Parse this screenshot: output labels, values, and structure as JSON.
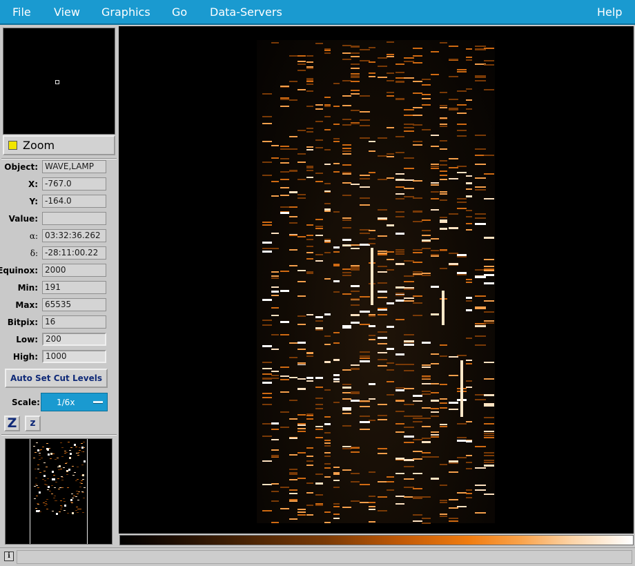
{
  "menu": {
    "file": "File",
    "view": "View",
    "graphics": "Graphics",
    "go": "Go",
    "data_servers": "Data-Servers",
    "help": "Help"
  },
  "zoom": {
    "label": "Zoom",
    "indicator_color": "#f2e600"
  },
  "info": {
    "object": {
      "label": "Object:",
      "value": "WAVE,LAMP"
    },
    "x": {
      "label": "X:",
      "value": "-767.0"
    },
    "y": {
      "label": "Y:",
      "value": "-164.0"
    },
    "value": {
      "label": "Value:",
      "value": ""
    },
    "alpha": {
      "label": "α:",
      "value": "03:32:36.262"
    },
    "delta": {
      "label": "δ:",
      "value": "-28:11:00.22"
    },
    "equinox": {
      "label": "Equinox:",
      "value": "2000"
    },
    "min": {
      "label": "Min:",
      "value": "191"
    },
    "max": {
      "label": "Max:",
      "value": "65535"
    },
    "bitpix": {
      "label": "Bitpix:",
      "value": "16"
    },
    "low": {
      "label": "Low:",
      "value": "200"
    },
    "high": {
      "label": "High:",
      "value": "1000"
    }
  },
  "controls": {
    "auto_cut": "Auto Set Cut Levels",
    "scale_label": "Scale:",
    "scale_value": "1/6x",
    "zoom_in": "Z",
    "zoom_out": "z"
  },
  "status": {
    "icon": "i",
    "text": ""
  },
  "colors": {
    "menubar": "#1a9ad0",
    "panel": "#c9c9c9",
    "accent_text": "#102a78",
    "colormap": [
      "#000000",
      "#7a3a06",
      "#f07c10",
      "#ffffff"
    ]
  }
}
